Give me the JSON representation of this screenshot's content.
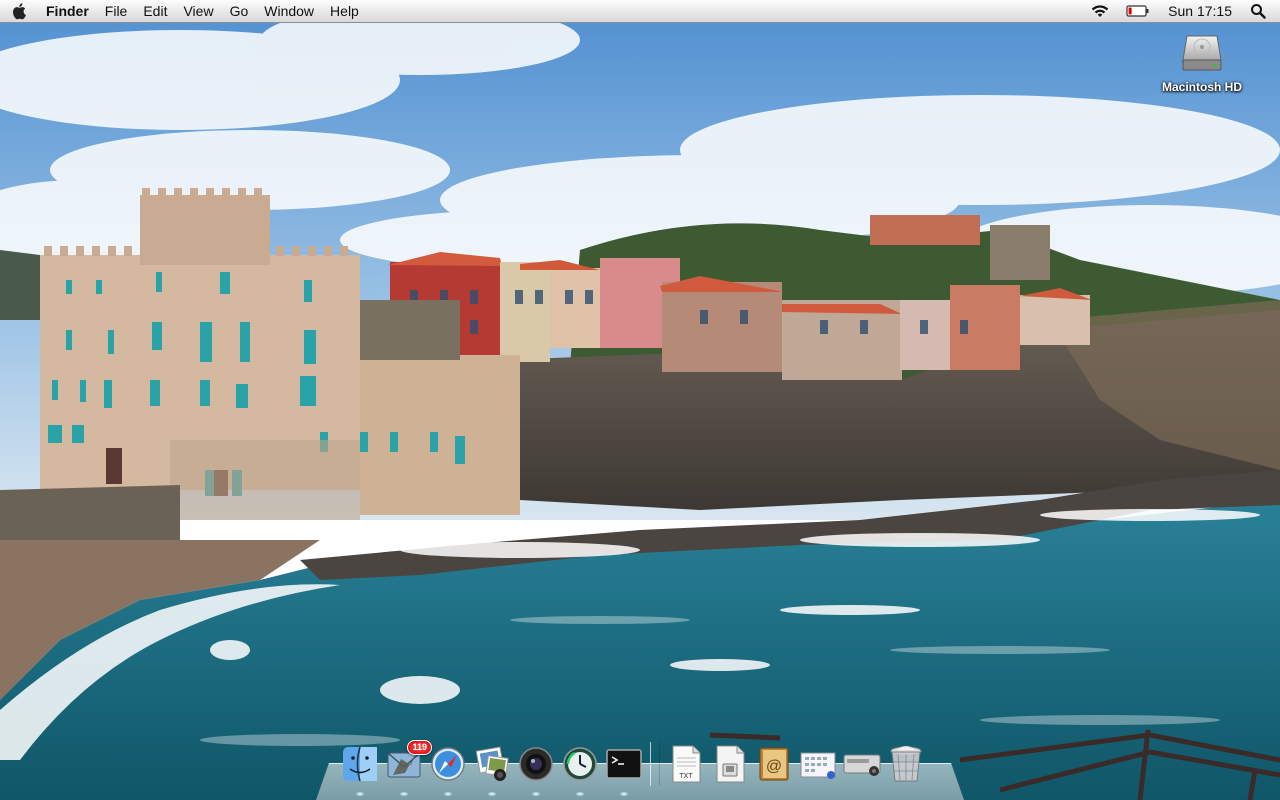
{
  "menubar": {
    "apple_icon": "apple-icon",
    "app_name": "Finder",
    "items": [
      {
        "label": "File"
      },
      {
        "label": "Edit"
      },
      {
        "label": "View"
      },
      {
        "label": "Go"
      },
      {
        "label": "Window"
      },
      {
        "label": "Help"
      }
    ],
    "status": {
      "wifi_icon": "wifi-icon",
      "battery_icon": "battery-icon",
      "clock": "Sun 17:15",
      "spotlight_icon": "spotlight-icon"
    }
  },
  "desktop": {
    "icons": [
      {
        "label": "Macintosh HD",
        "icon": "hard-drive-icon"
      }
    ],
    "wallpaper": "seaside-town-wallpaper"
  },
  "dock": {
    "apps": [
      {
        "name": "finder-icon"
      },
      {
        "name": "mail-icon",
        "badge": "119"
      },
      {
        "name": "safari-icon"
      },
      {
        "name": "iphoto-icon"
      },
      {
        "name": "photo-booth-icon"
      },
      {
        "name": "time-machine-icon"
      },
      {
        "name": "terminal-icon"
      }
    ],
    "documents": [
      {
        "name": "text-document-icon",
        "label": "TXT"
      },
      {
        "name": "document-icon"
      },
      {
        "name": "address-book-icon"
      },
      {
        "name": "calendar-grid-icon"
      },
      {
        "name": "hardware-device-icon"
      },
      {
        "name": "trash-icon"
      }
    ]
  },
  "colors": {
    "sky": "#6da5d8",
    "sea": "#1f6f86",
    "menubar": "#e8e8e8",
    "badge": "#d40000"
  }
}
